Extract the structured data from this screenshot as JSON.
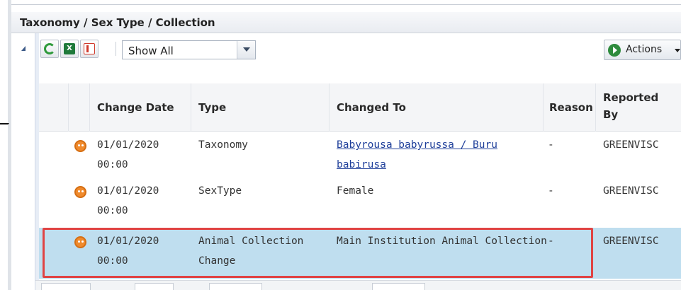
{
  "panel": {
    "title": "Taxonomy / Sex Type / Collection"
  },
  "toolbar": {
    "filter_value": "Show All",
    "actions_label": "Actions",
    "icons": [
      "refresh-icon",
      "excel-export-icon",
      "pdf-export-icon"
    ]
  },
  "table": {
    "columns": [
      "Change Date",
      "Type",
      "Changed To",
      "Reason",
      "Reported By"
    ],
    "rows": [
      {
        "date_line1": "01/01/2020",
        "date_line2": "00:00",
        "type_line1": "Taxonomy",
        "type_line2": "",
        "changed_to_line1": "Babyrousa babyrussa / Buru",
        "changed_to_line2": "babirusa",
        "reason": "-",
        "reported_by": "GREENVISC"
      },
      {
        "date_line1": "01/01/2020",
        "date_line2": "00:00",
        "type_line1": "SexType",
        "type_line2": "",
        "changed_to_line1": "Female",
        "changed_to_line2": "",
        "reason": "-",
        "reported_by": "GREENVISC"
      },
      {
        "date_line1": "01/01/2020",
        "date_line2": "00:00",
        "type_line1": "Animal Collection",
        "type_line2": "Change",
        "changed_to_line1": "Main Institution Animal Collection",
        "changed_to_line2": "",
        "reason": "-",
        "reported_by": "GREENVISC"
      }
    ]
  },
  "colors": {
    "selected_row": "#bfdeef",
    "highlight_border": "#e04343",
    "row_icon": "#f08a2c",
    "link": "#1f3f9a"
  }
}
